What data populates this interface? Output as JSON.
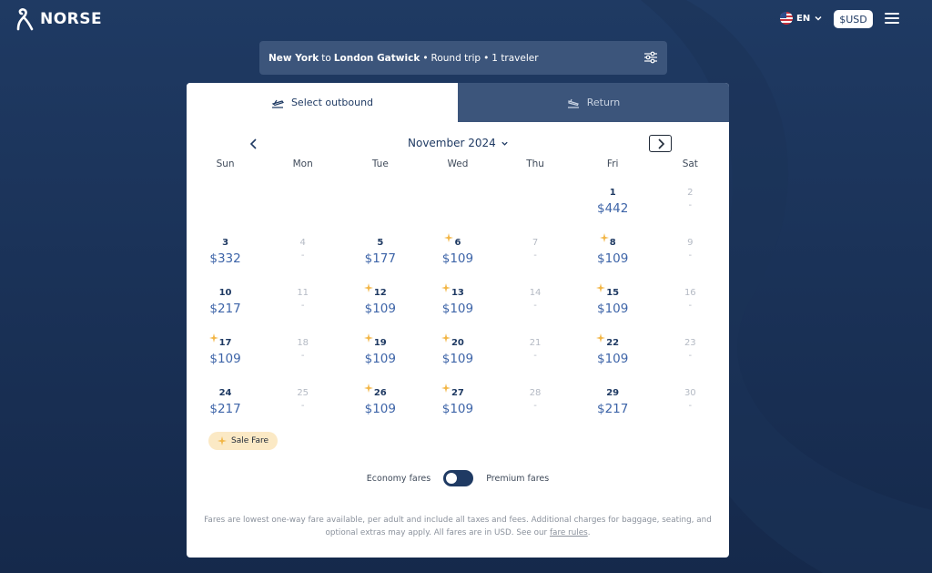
{
  "header": {
    "logo_text": "NORSE",
    "language": "EN",
    "currency": "$USD"
  },
  "summary": {
    "origin": "New York",
    "to_word": "to",
    "destination": "London Gatwick",
    "trip_type": "Round trip",
    "travelers": "1 traveler"
  },
  "tabs": [
    {
      "label": "Select outbound",
      "active": true
    },
    {
      "label": "Return",
      "active": false
    }
  ],
  "calendar": {
    "month": "November 2024",
    "weekdays": [
      "Sun",
      "Mon",
      "Tue",
      "Wed",
      "Thu",
      "Fri",
      "Sat"
    ],
    "weeks": [
      [
        null,
        null,
        null,
        null,
        null,
        {
          "day": "1",
          "price": "$442",
          "sale": false
        },
        {
          "day": "2",
          "price": "-",
          "sale": false
        }
      ],
      [
        {
          "day": "3",
          "price": "$332",
          "sale": false
        },
        {
          "day": "4",
          "price": "-",
          "sale": false
        },
        {
          "day": "5",
          "price": "$177",
          "sale": false
        },
        {
          "day": "6",
          "price": "$109",
          "sale": true
        },
        {
          "day": "7",
          "price": "-",
          "sale": false
        },
        {
          "day": "8",
          "price": "$109",
          "sale": true
        },
        {
          "day": "9",
          "price": "-",
          "sale": false
        }
      ],
      [
        {
          "day": "10",
          "price": "$217",
          "sale": false
        },
        {
          "day": "11",
          "price": "-",
          "sale": false
        },
        {
          "day": "12",
          "price": "$109",
          "sale": true
        },
        {
          "day": "13",
          "price": "$109",
          "sale": true
        },
        {
          "day": "14",
          "price": "-",
          "sale": false
        },
        {
          "day": "15",
          "price": "$109",
          "sale": true
        },
        {
          "day": "16",
          "price": "-",
          "sale": false
        }
      ],
      [
        {
          "day": "17",
          "price": "$109",
          "sale": true
        },
        {
          "day": "18",
          "price": "-",
          "sale": false
        },
        {
          "day": "19",
          "price": "$109",
          "sale": true
        },
        {
          "day": "20",
          "price": "$109",
          "sale": true
        },
        {
          "day": "21",
          "price": "-",
          "sale": false
        },
        {
          "day": "22",
          "price": "$109",
          "sale": true
        },
        {
          "day": "23",
          "price": "-",
          "sale": false
        }
      ],
      [
        {
          "day": "24",
          "price": "$217",
          "sale": false
        },
        {
          "day": "25",
          "price": "-",
          "sale": false
        },
        {
          "day": "26",
          "price": "$109",
          "sale": true
        },
        {
          "day": "27",
          "price": "$109",
          "sale": true
        },
        {
          "day": "28",
          "price": "-",
          "sale": false
        },
        {
          "day": "29",
          "price": "$217",
          "sale": false
        },
        {
          "day": "30",
          "price": "-",
          "sale": false
        }
      ]
    ]
  },
  "legend": {
    "sale_label": "Sale Fare"
  },
  "fare_toggle": {
    "left_label": "Economy fares",
    "right_label": "Premium fares"
  },
  "footnote": {
    "text": "Fares are lowest one-way fare available, per adult and include all taxes and fees. Additional charges for baggage, seating, and optional extras may apply. All fares are in USD. See our",
    "link_text": "fare rules",
    "end": "."
  },
  "colors": {
    "navy": "#1f3a63",
    "price_blue": "#3d64a8",
    "sale_gold": "#f2b544",
    "sale_badge_bg": "#fbe9c5"
  }
}
